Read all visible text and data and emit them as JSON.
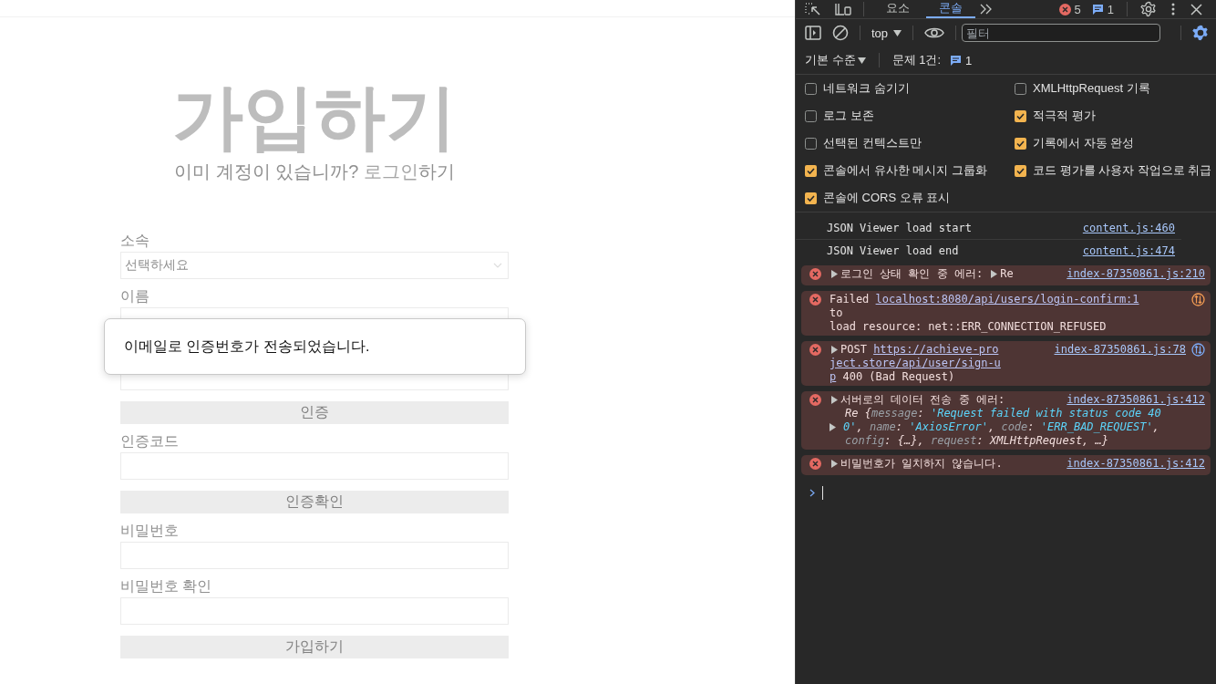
{
  "page": {
    "title": "가입하기",
    "subtitle": "이미 계정이 있습니까? ",
    "login_link": "로그인",
    "subtitle_end": "하기",
    "fields": [
      {
        "kind": "select",
        "label": "소속",
        "placeholder": "선택하세요"
      },
      {
        "kind": "input",
        "label": "이름"
      },
      {
        "kind": "input"
      },
      {
        "kind": "button",
        "label": "인증"
      },
      {
        "kind": "input",
        "label": "인증코드"
      },
      {
        "kind": "button",
        "label": "인증확인"
      },
      {
        "kind": "input",
        "label": "비밀번호"
      },
      {
        "kind": "input",
        "label": "비밀번호 확인"
      },
      {
        "kind": "button",
        "label": "가입하기"
      }
    ]
  },
  "dialog": {
    "message": "이메일로 인증번호가 전송되었습니다."
  },
  "devtools": {
    "tabs": [
      {
        "label": "요소",
        "selected": false
      },
      {
        "label": "콘솔",
        "selected": true
      }
    ],
    "error_count": "5",
    "message_count": "1",
    "context": "top",
    "filter_placeholder": "필터",
    "log_level": "기본 수준",
    "issues_label": "문제 1건:",
    "issues_count": "1",
    "settings": [
      {
        "label": "네트워크 숨기기",
        "checked": false
      },
      {
        "label": "XMLHttpRequest 기록",
        "checked": false
      },
      {
        "label": "로그 보존",
        "checked": false
      },
      {
        "label": "적극적 평가",
        "checked": true
      },
      {
        "label": "선택된 컨텍스트만",
        "checked": false
      },
      {
        "label": "기록에서 자동 완성",
        "checked": true
      },
      {
        "label": "콘솔에서 유사한 메시지 그룹화",
        "checked": true
      },
      {
        "label": "코드 평가를 사용자 작업으로 취급",
        "checked": true
      },
      {
        "label": "콘솔에 CORS 오류 표시",
        "checked": true
      }
    ],
    "messages": [
      {
        "kind": "info",
        "expandable": false,
        "network_icon": false,
        "source": "content.js:460",
        "lines": [
          {
            "kind": "text",
            "segments": [
              {
                "kind": "text",
                "text": "JSON Viewer load start"
              }
            ]
          }
        ]
      },
      {
        "kind": "info",
        "expandable": false,
        "network_icon": false,
        "source": "content.js:474",
        "lines": [
          {
            "kind": "text",
            "segments": [
              {
                "kind": "text",
                "text": "JSON Viewer load end"
              }
            ]
          }
        ]
      },
      {
        "kind": "error",
        "expandable": true,
        "network_icon": false,
        "source": "index-87350861.js:210",
        "lines": [
          {
            "kind": "text",
            "segments": [
              {
                "kind": "text",
                "text": "로그인 상태 확인 중 에러: "
              },
              {
                "kind": "toggle"
              },
              {
                "kind": "text",
                "text": "Re"
              }
            ]
          }
        ]
      },
      {
        "kind": "error",
        "expandable": false,
        "network_icon": true,
        "lines": [
          {
            "kind": "text",
            "segments": [
              {
                "kind": "text",
                "text": "Failed "
              },
              {
                "kind": "link",
                "text": "localhost:8080/api/users/login-confirm:1"
              }
            ]
          },
          {
            "kind": "text",
            "segments": [
              {
                "kind": "text",
                "text": "to"
              }
            ]
          },
          {
            "kind": "text",
            "segments": [
              {
                "kind": "text",
                "text": "load resource: net::ERR_CONNECTION_REFUSED"
              }
            ]
          }
        ]
      },
      {
        "kind": "error",
        "expandable": true,
        "network_icon": true,
        "source": "index-87350861.js:78",
        "lines": [
          {
            "kind": "text",
            "segments": [
              {
                "kind": "text",
                "text": "POST "
              },
              {
                "kind": "link",
                "text": "https://achieve-pro"
              }
            ]
          },
          {
            "kind": "text",
            "segments": [
              {
                "kind": "link",
                "text": "ject.store/api/user/sign-u"
              }
            ]
          },
          {
            "kind": "text",
            "segments": [
              {
                "kind": "link",
                "text": "p"
              },
              {
                "kind": "text",
                "text": " 400 (Bad Request)"
              }
            ]
          }
        ]
      },
      {
        "kind": "error",
        "expandable": true,
        "network_icon": false,
        "source": "index-87350861.js:412",
        "lines": [
          {
            "kind": "text",
            "segments": [
              {
                "kind": "text",
                "text": "서버로의 데이터 전송 중 에러:"
              }
            ]
          },
          {
            "kind": "object",
            "segments": [
              {
                "kind": "obj",
                "text": "Re {"
              },
              {
                "kind": "key",
                "text": "message"
              },
              {
                "kind": "obj",
                "text": ": "
              },
              {
                "kind": "str",
                "text": "'Request failed with status code 40"
              }
            ]
          },
          {
            "kind": "object",
            "segments": [
              {
                "kind": "toggle"
              },
              {
                "kind": "str",
                "text": "0'"
              },
              {
                "kind": "obj",
                "text": ", "
              },
              {
                "kind": "key",
                "text": "name"
              },
              {
                "kind": "obj",
                "text": ": "
              },
              {
                "kind": "str",
                "text": "'AxiosError'"
              },
              {
                "kind": "obj",
                "text": ", "
              },
              {
                "kind": "key",
                "text": "code"
              },
              {
                "kind": "obj",
                "text": ": "
              },
              {
                "kind": "str",
                "text": "'ERR_BAD_REQUEST'"
              },
              {
                "kind": "obj",
                "text": ","
              }
            ]
          },
          {
            "kind": "object",
            "segments": [
              {
                "kind": "key",
                "text": "config"
              },
              {
                "kind": "obj",
                "text": ": {…}, "
              },
              {
                "kind": "key",
                "text": "request"
              },
              {
                "kind": "obj",
                "text": ": XMLHttpRequest, …}"
              }
            ]
          }
        ]
      },
      {
        "kind": "error",
        "expandable": true,
        "network_icon": false,
        "source": "index-87350861.js:412",
        "lines": [
          {
            "kind": "text",
            "segments": [
              {
                "kind": "text",
                "text": "비밀번호가 일치하지 않습니다."
              }
            ]
          }
        ]
      }
    ]
  }
}
